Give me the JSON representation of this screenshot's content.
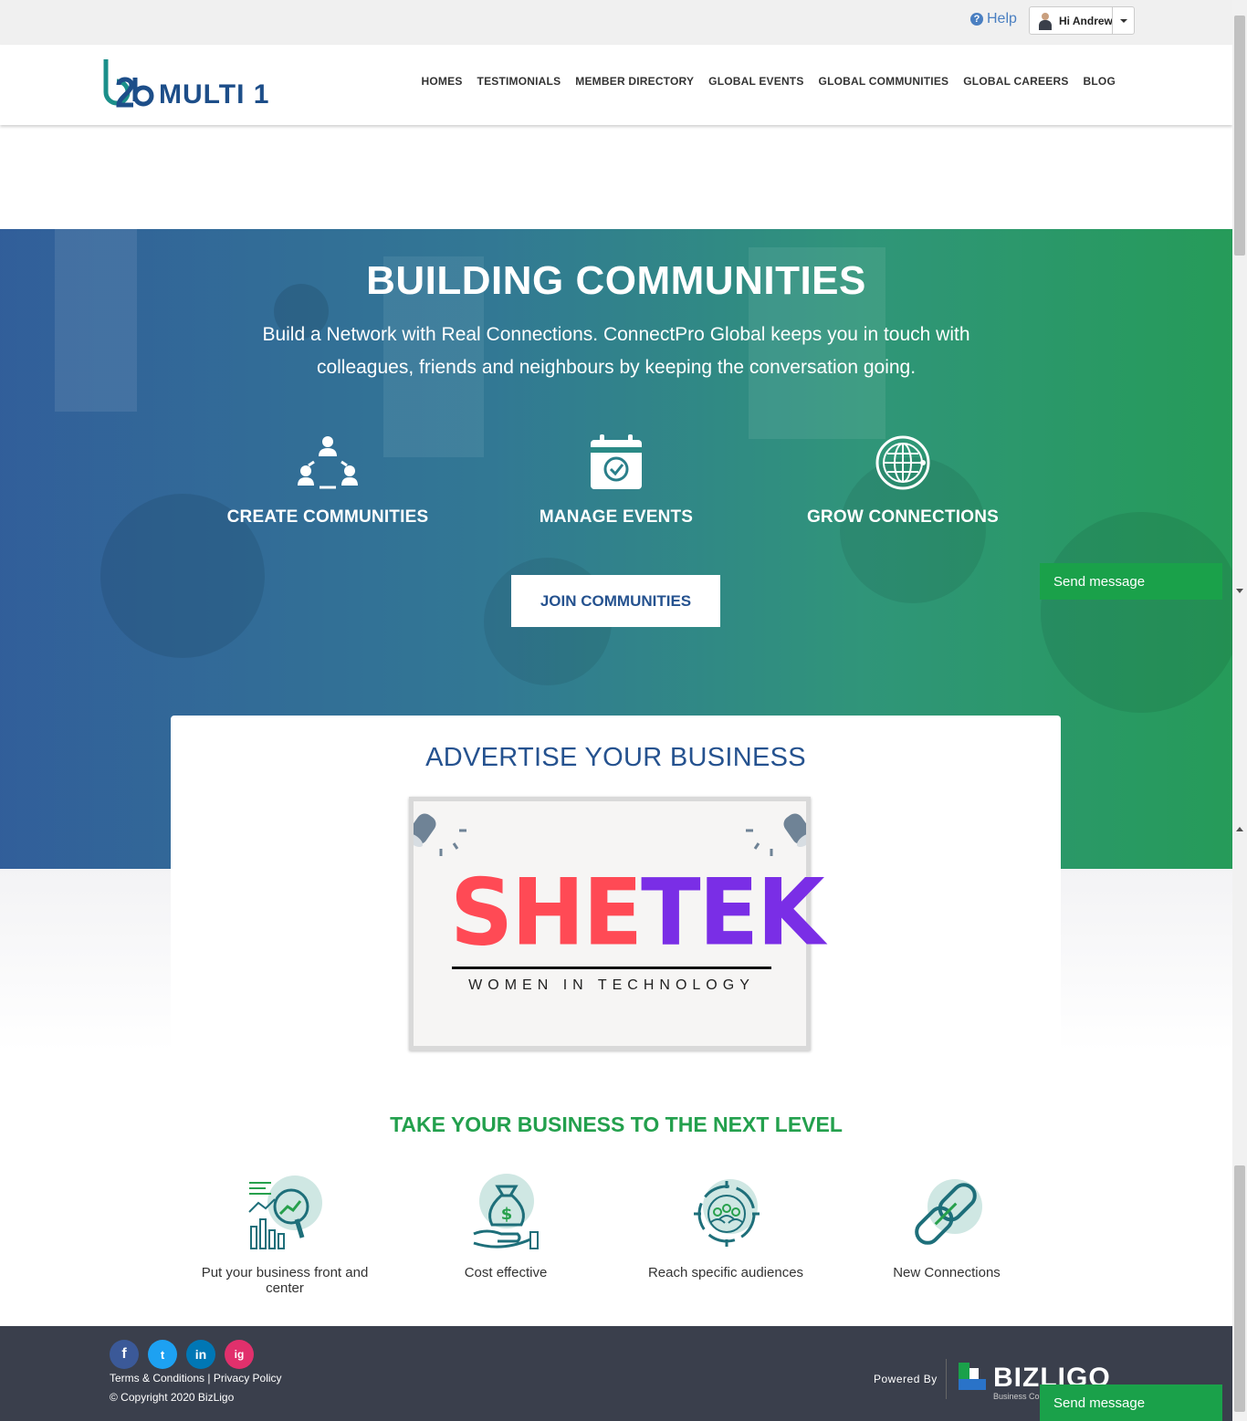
{
  "topbar": {
    "help_label": "Help",
    "user_greeting": "Hi Andrew"
  },
  "header": {
    "logo_text": "MULTI 1",
    "nav": [
      {
        "label": "HOMES"
      },
      {
        "label": "TESTIMONIALS"
      },
      {
        "label": "MEMBER DIRECTORY"
      },
      {
        "label": "GLOBAL EVENTS"
      },
      {
        "label": "GLOBAL COMMUNITIES"
      },
      {
        "label": "GLOBAL CAREERS"
      },
      {
        "label": "BLOG"
      }
    ]
  },
  "hero": {
    "title": "BUILDING COMMUNITIES",
    "subtitle": "Build a Network with Real Connections. ConnectPro Global keeps you in touch with colleagues, friends and neighbours by keeping the conversation going.",
    "features": [
      {
        "label": "CREATE COMMUNITIES",
        "icon": "community-icon"
      },
      {
        "label": "MANAGE EVENTS",
        "icon": "calendar-check-icon"
      },
      {
        "label": "GROW CONNECTIONS",
        "icon": "globe-icon"
      }
    ],
    "cta_label": "JOIN COMMUNITIES"
  },
  "advertise": {
    "title": "ADVERTISE YOUR BUSINESS",
    "ad": {
      "brand_part1": "SHE",
      "brand_part2": "TEK",
      "tagline": "WOMEN IN TECHNOLOGY",
      "colors": {
        "she": "#ff4a55",
        "tek": "#7a2ee6"
      }
    }
  },
  "next_level": {
    "title": "TAKE YOUR BUSINESS TO THE NEXT LEVEL",
    "benefits": [
      {
        "label": "Put your business front and center",
        "icon": "analytics-icon"
      },
      {
        "label": "Cost effective",
        "icon": "money-bag-icon"
      },
      {
        "label": "Reach specific audiences",
        "icon": "target-audience-icon"
      },
      {
        "label": "New Connections",
        "icon": "chain-link-icon"
      }
    ]
  },
  "footer": {
    "socials": [
      {
        "icon": "facebook-icon",
        "glyph": "f",
        "color": "#3b5998"
      },
      {
        "icon": "twitter-icon",
        "glyph": "t",
        "color": "#1da1f2"
      },
      {
        "icon": "linkedin-icon",
        "glyph": "in",
        "color": "#0077b5"
      },
      {
        "icon": "instagram-icon",
        "glyph": "ig",
        "color": "#e1306c"
      }
    ],
    "terms_label": "Terms & Conditions",
    "separator": "|",
    "privacy_label": "Privacy Policy",
    "copyright": "© Copyright 2020 BizLigo",
    "powered_by": "Powered By",
    "brand_name": "BIZLIGO",
    "brand_sub": "Business Co"
  },
  "chat": {
    "send_label": "Send message"
  },
  "colors": {
    "primary_blue": "#25528f",
    "accent_green": "#23a04d",
    "footer_bg": "#3a3f4c",
    "chat_green": "#1aa14a"
  }
}
